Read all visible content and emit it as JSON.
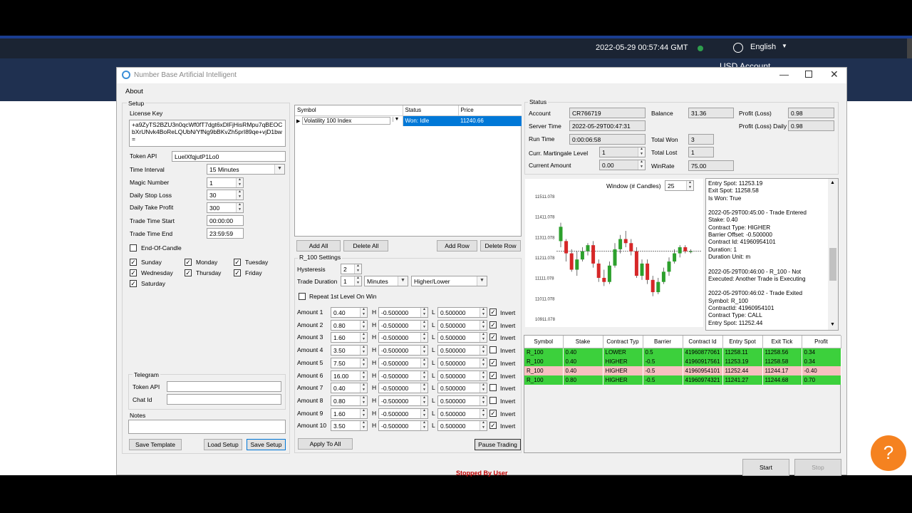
{
  "topbar": {
    "datetime": "2022-05-29 00:57:44 GMT",
    "language": "English",
    "account_hint": "USD Account"
  },
  "window": {
    "title": "Number Base Artificial Intelligent"
  },
  "menu": {
    "about": "About"
  },
  "setup": {
    "group_label": "Setup",
    "license_label": "License Key",
    "license_value": "+a9ZyTS2BZU3n0qcWf0fT7dgt6xDlFjHisRMpu7qBEOCbXrUNvk4BoReLQUbN/YfNg9bBKvZh5prI89qe+vjD1bw=",
    "token_api_label": "Token API",
    "token_api_value": "LuelXfqjutP1Lo0",
    "time_interval_label": "Time Interval",
    "time_interval_value": "15 Minutes",
    "magic_number_label": "Magic Number",
    "magic_number_value": "1",
    "daily_stop_loss_label": "Daily Stop Loss",
    "daily_stop_loss_value": "30",
    "daily_take_profit_label": "Daily Take Profit",
    "daily_take_profit_value": "300",
    "trade_time_start_label": "Trade Time Start",
    "trade_time_start_value": "00:00:00",
    "trade_time_end_label": "Trade Time End",
    "trade_time_end_value": "23:59:59",
    "end_of_candle_label": "End-Of-Candle",
    "days": [
      {
        "label": "Sunday",
        "checked": true
      },
      {
        "label": "Monday",
        "checked": true
      },
      {
        "label": "Tuesday",
        "checked": true
      },
      {
        "label": "Wednesday",
        "checked": true
      },
      {
        "label": "Thursday",
        "checked": true
      },
      {
        "label": "Friday",
        "checked": true
      },
      {
        "label": "Saturday",
        "checked": true
      }
    ],
    "telegram_label": "Telegram",
    "telegram_token_label": "Token API",
    "chat_id_label": "Chat Id",
    "notes_label": "Notes",
    "save_template": "Save Template",
    "load_setup": "Load Setup",
    "save_setup": "Save Setup"
  },
  "symbols": {
    "headers": [
      "Symbol",
      "Status",
      "Price"
    ],
    "row": {
      "symbol": "Volatility 100 Index",
      "status": "Won: Idle",
      "price": "11240.66"
    },
    "add_all": "Add All",
    "delete_all": "Delete All",
    "add_row": "Add Row",
    "delete_row": "Delete Row"
  },
  "r100": {
    "group_label": "R_100 Settings",
    "hysteresis_label": "Hysteresis",
    "hysteresis_value": "2",
    "trade_duration_label": "Trade Duration",
    "trade_duration_value": "1",
    "duration_unit": "Minutes",
    "contract_mode": "Higher/Lower",
    "repeat_label": "Repeat 1st Level On Win",
    "h_label": "H",
    "l_label": "L",
    "invert_label": "Invert",
    "amounts": [
      {
        "label": "Amount 1",
        "value": "0.40",
        "h": "-0.500000",
        "l": "0.500000",
        "invert": true
      },
      {
        "label": "Amount 2",
        "value": "0.80",
        "h": "-0.500000",
        "l": "0.500000",
        "invert": true
      },
      {
        "label": "Amount 3",
        "value": "1.60",
        "h": "-0.500000",
        "l": "0.500000",
        "invert": true
      },
      {
        "label": "Amount 4",
        "value": "3.50",
        "h": "-0.500000",
        "l": "0.500000",
        "invert": false
      },
      {
        "label": "Amount 5",
        "value": "7.50",
        "h": "-0.500000",
        "l": "0.500000",
        "invert": true
      },
      {
        "label": "Amount 6",
        "value": "16.00",
        "h": "-0.500000",
        "l": "0.500000",
        "invert": true
      },
      {
        "label": "Amount 7",
        "value": "0.40",
        "h": "-0.500000",
        "l": "0.500000",
        "invert": false
      },
      {
        "label": "Amount 8",
        "value": "0.80",
        "h": "-0.500000",
        "l": "0.500000",
        "invert": false
      },
      {
        "label": "Amount 9",
        "value": "1.60",
        "h": "-0.500000",
        "l": "0.500000",
        "invert": true
      },
      {
        "label": "Amount 10",
        "value": "3.50",
        "h": "-0.500000",
        "l": "0.500000",
        "invert": true
      }
    ],
    "apply_to_all": "Apply To All",
    "pause_trading": "Pause Trading"
  },
  "status": {
    "group_label": "Status",
    "account_label": "Account",
    "account_value": "CR766719",
    "balance_label": "Balance",
    "balance_value": "31.36",
    "profit_loss_label": "Profit (Loss)",
    "profit_loss_value": "0.98",
    "server_time_label": "Server Time",
    "server_time_value": "2022-05-29T00:47:31",
    "profit_loss_daily_label": "Profit (Loss) Daily",
    "profit_loss_daily_value": "0.98",
    "run_time_label": "Run Time",
    "run_time_value": "0:00:06:58",
    "total_won_label": "Total Won",
    "total_won_value": "3",
    "martingale_label": "Curr. Martingale Level",
    "martingale_value": "1",
    "total_lost_label": "Total Lost",
    "total_lost_value": "1",
    "current_amount_label": "Current Amount",
    "current_amount_value": "0.00",
    "winrate_label": "WinRate",
    "winrate_value": "75.00"
  },
  "chart_data": {
    "type": "candlestick",
    "window_label": "Window (# Candles)",
    "window_value": "25",
    "y_ticks": [
      "11511.078",
      "11411.078",
      "11311.078",
      "11211.078",
      "11111.078",
      "11011.078",
      "10911.078"
    ],
    "ylim": [
      10911.078,
      11511.078
    ],
    "reference_line": 11240.66,
    "candles": [
      {
        "o": 11290,
        "c": 11360,
        "h": 11380,
        "l": 11260
      },
      {
        "o": 11290,
        "c": 11230,
        "h": 11300,
        "l": 11190
      },
      {
        "o": 11230,
        "c": 11150,
        "h": 11250,
        "l": 11140
      },
      {
        "o": 11150,
        "c": 11200,
        "h": 11240,
        "l": 11120
      },
      {
        "o": 11200,
        "c": 11240,
        "h": 11260,
        "l": 11190
      },
      {
        "o": 11240,
        "c": 11270,
        "h": 11280,
        "l": 11220
      },
      {
        "o": 11270,
        "c": 11180,
        "h": 11290,
        "l": 11160
      },
      {
        "o": 11180,
        "c": 11110,
        "h": 11200,
        "l": 11090
      },
      {
        "o": 11110,
        "c": 11090,
        "h": 11150,
        "l": 11070
      },
      {
        "o": 11090,
        "c": 11170,
        "h": 11190,
        "l": 11080
      },
      {
        "o": 11170,
        "c": 11250,
        "h": 11280,
        "l": 11160
      },
      {
        "o": 11250,
        "c": 11300,
        "h": 11320,
        "l": 11230
      },
      {
        "o": 11300,
        "c": 11280,
        "h": 11340,
        "l": 11260
      },
      {
        "o": 11280,
        "c": 11240,
        "h": 11300,
        "l": 11220
      },
      {
        "o": 11240,
        "c": 11120,
        "h": 11260,
        "l": 11110
      },
      {
        "o": 11120,
        "c": 11180,
        "h": 11200,
        "l": 11100
      },
      {
        "o": 11180,
        "c": 11100,
        "h": 11200,
        "l": 11080
      },
      {
        "o": 11100,
        "c": 11040,
        "h": 11120,
        "l": 11020
      },
      {
        "o": 11040,
        "c": 11090,
        "h": 11110,
        "l": 11030
      },
      {
        "o": 11090,
        "c": 11140,
        "h": 11160,
        "l": 11080
      },
      {
        "o": 11140,
        "c": 11190,
        "h": 11210,
        "l": 11120
      },
      {
        "o": 11190,
        "c": 11230,
        "h": 11250,
        "l": 11180
      },
      {
        "o": 11230,
        "c": 11260,
        "h": 11270,
        "l": 11210
      },
      {
        "o": 11260,
        "c": 11240,
        "h": 11270,
        "l": 11230
      },
      {
        "o": 11240,
        "c": 11240,
        "h": 11250,
        "l": 11230
      }
    ]
  },
  "log": [
    "Entry Spot: 11253.19",
    "Exit Spot: 11258.58",
    "Is Won: True",
    "",
    "2022-05-29T00:45:00 - Trade Entered",
    "Stake: 0.40",
    "Contract Type: HIGHER",
    "Barrier Offset: -0.500000",
    "Contract Id: 41960954101",
    "Duration: 1",
    "Duration Unit: m",
    "",
    "2022-05-29T00:46:00 - R_100 - Not",
    "Executed: Another Trade is Executing",
    "",
    "2022-05-29T00:46:02 - Trade Exited",
    "Symbol: R_100",
    "ContractId: 41960954101",
    "Contract Type: CALL",
    "Entry Spot: 11252.44"
  ],
  "trades": {
    "headers": [
      "Symbol",
      "Stake",
      "Contract Typ",
      "Barrier",
      "Contract Id",
      "Entry Spot",
      "Exit Tick",
      "Profit"
    ],
    "rows": [
      {
        "cells": [
          "R_100",
          "0.40",
          "LOWER",
          "0.5",
          "41960877061",
          "11258.11",
          "11258.56",
          "0.34"
        ],
        "won": true
      },
      {
        "cells": [
          "R_100",
          "0.40",
          "HIGHER",
          "-0.5",
          "41960917561",
          "11253.19",
          "11258.58",
          "0.34"
        ],
        "won": true
      },
      {
        "cells": [
          "R_100",
          "0.40",
          "HIGHER",
          "-0.5",
          "41960954101",
          "11252.44",
          "11244.17",
          "-0.40"
        ],
        "won": false
      },
      {
        "cells": [
          "R_100",
          "0.80",
          "HIGHER",
          "-0.5",
          "41960974321",
          "11241.27",
          "11244.68",
          "0.70"
        ],
        "won": true
      }
    ]
  },
  "footer": {
    "status_text": "Stopped By User",
    "start": "Start",
    "stop": "Stop"
  },
  "colors": {
    "won_row": "#3cd03c",
    "lost_row": "#f7c0c0",
    "selected": "#0078d7",
    "bull": "#2ca02c",
    "bear": "#d62728",
    "help_button": "#f58220"
  }
}
